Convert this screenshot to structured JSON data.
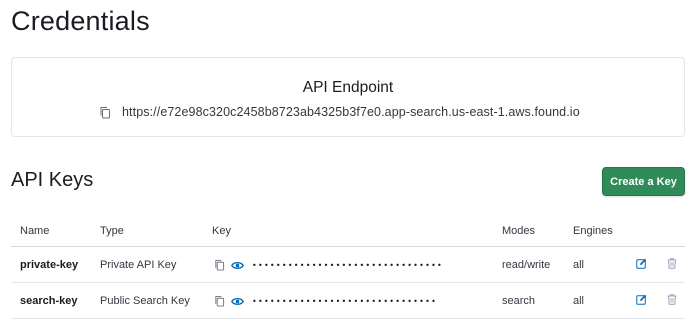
{
  "page": {
    "title": "Credentials"
  },
  "endpoint": {
    "title": "API Endpoint",
    "url": "https://e72e98c320c2458b8723ab4325b3f7e0.app-search.us-east-1.aws.found.io"
  },
  "api_keys": {
    "title": "API Keys",
    "create_label": "Create a Key",
    "columns": [
      "Name",
      "Type",
      "Key",
      "Modes",
      "Engines"
    ],
    "rows": [
      {
        "name": "private-key",
        "type": "Private API Key",
        "key_mask": "••••••••••••••••••••••••••••••••",
        "modes": "read/write",
        "engines": "all"
      },
      {
        "name": "search-key",
        "type": "Public Search Key",
        "key_mask": "•••••••••••••••••••••••••••••••",
        "modes": "search",
        "engines": "all"
      }
    ]
  },
  "colors": {
    "primary": "#2f8b57",
    "link": "#006bb8",
    "muted_icon": "#98a2b3"
  },
  "icons": {
    "copy": "copy-icon",
    "reveal": "eye-icon",
    "edit": "pencil-icon",
    "delete": "trash-icon"
  }
}
